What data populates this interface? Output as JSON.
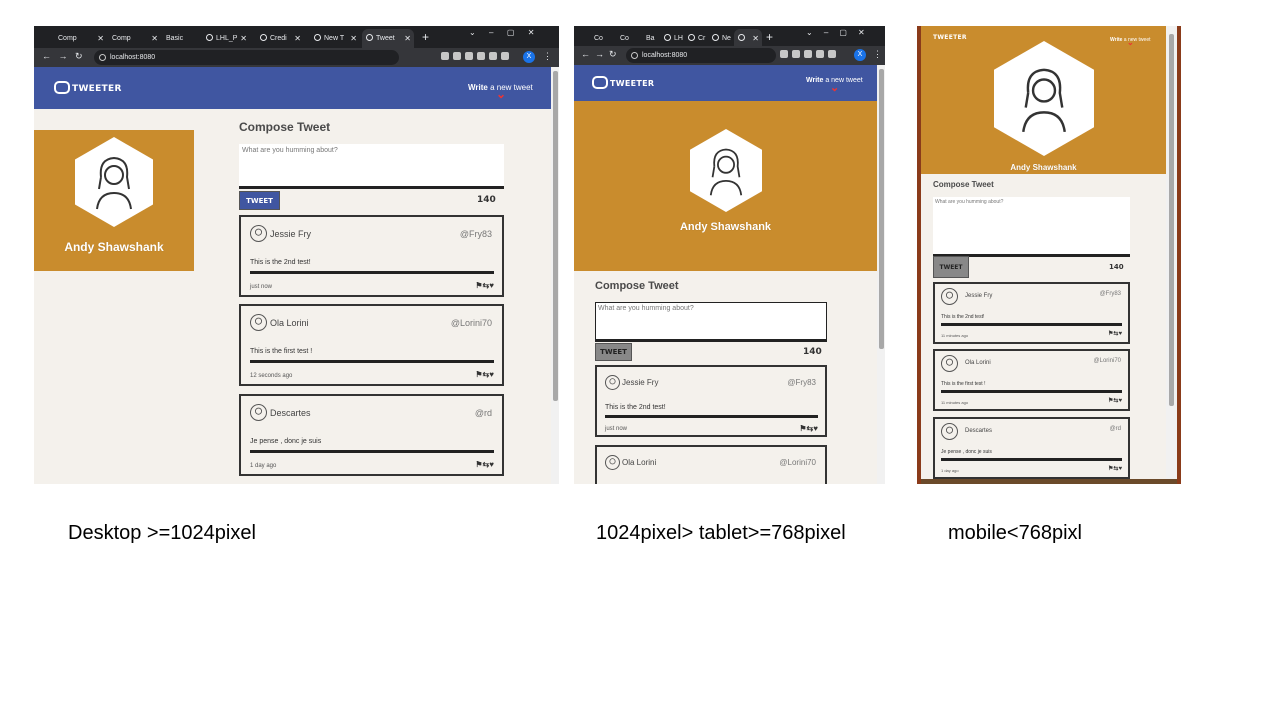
{
  "captions": {
    "desktop": "Desktop >=1024pixel",
    "tablet": "1024pixel> tablet>=768pixel",
    "mobile": "mobile<768pixl"
  },
  "desktop": {
    "tabs": [
      "Comp",
      "Comp",
      "Basic",
      "LHL_P",
      "Credi",
      "New T",
      "Tweet"
    ],
    "url": "localhost:8080",
    "avatar_letter": "X"
  },
  "tablet": {
    "tabs": [
      "Co",
      "Co",
      "Ba",
      "LH",
      "Cr",
      "Ne",
      ""
    ],
    "url": "localhost:8080",
    "avatar_letter": "X"
  },
  "app": {
    "logo": "TWEETER",
    "write_bold": "Write",
    "write_rest": " a new tweet",
    "arrow": "⌄",
    "profile_name": "Andy Shawshank",
    "compose_title": "Compose Tweet",
    "placeholder": "What are you humming about?",
    "tweet_button": "TWEET",
    "counter": "140",
    "actions": "⚑⇆♥"
  },
  "tweets": [
    {
      "name": "Jessie Fry",
      "handle": "@Fry83",
      "content": "This is the 2nd test!",
      "time": "just now",
      "time_mobile": "11 minutes ago"
    },
    {
      "name": "Ola Lorini",
      "handle": "@Lorini70",
      "content": "This is the first test !",
      "time": "12 seconds ago",
      "time_mobile": "11 minutes ago"
    },
    {
      "name": "Descartes",
      "handle": "@rd",
      "content": "Je pense , donc je suis",
      "time": "1 day ago",
      "time_mobile": "1 day ago"
    }
  ],
  "colors": {
    "navbar": "#4056a1",
    "profile": "#c98c2d",
    "page_bg": "#f4f1ec",
    "tweet_btn_desktop": "#4056a1",
    "tweet_btn_other": "#888888"
  }
}
